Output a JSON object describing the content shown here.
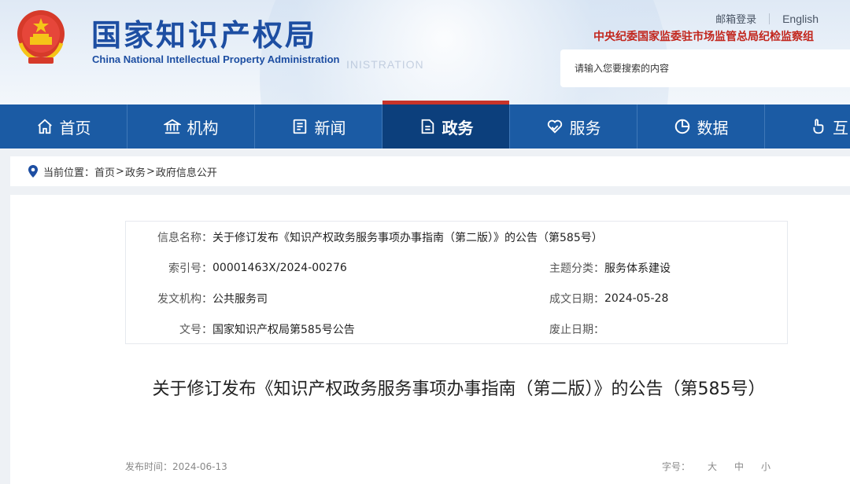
{
  "header": {
    "site_title": "国家知识产权局",
    "site_subtitle": "China National Intellectual Property Administration",
    "faint_text": "INISTRATION",
    "top_links": {
      "mail": "邮箱登录",
      "english": "English"
    },
    "org_note": "中央纪委国家监委驻市场监管总局纪检监察组",
    "search": {
      "placeholder": "请输入您要搜索的内容",
      "value": ""
    }
  },
  "nav": {
    "items": [
      {
        "label": "首页",
        "icon": "home-icon"
      },
      {
        "label": "机构",
        "icon": "institution-icon"
      },
      {
        "label": "新闻",
        "icon": "news-icon"
      },
      {
        "label": "政务",
        "icon": "document-icon",
        "active": true
      },
      {
        "label": "服务",
        "icon": "heart-hand-icon"
      },
      {
        "label": "数据",
        "icon": "pie-chart-icon"
      },
      {
        "label": "互",
        "icon": "hand-pointer-icon"
      }
    ]
  },
  "breadcrumb": {
    "prefix": "当前位置：",
    "items": [
      "首页",
      "政务",
      "政府信息公开"
    ],
    "separator": ">"
  },
  "info": {
    "name_label": "信息名称：",
    "name_value": "关于修订发布《知识产权政务服务事项办事指南（第二版）》的公告（第585号）",
    "index_label": "索引号：",
    "index_value": "00001463X/2024-00276",
    "topic_label": "主题分类：",
    "topic_value": "服务体系建设",
    "issuer_label": "发文机构：",
    "issuer_value": "公共服务司",
    "date_label": "成文日期：",
    "date_value": "2024-05-28",
    "docno_label": "文号：",
    "docno_value": "国家知识产权局第585号公告",
    "expire_label": "废止日期：",
    "expire_value": ""
  },
  "article": {
    "title": "关于修订发布《知识产权政务服务事项办事指南（第二版）》的公告（第585号）",
    "publish_label": "发布时间：",
    "publish_date": "2024-06-13",
    "font_size_label": "字号：",
    "font_sizes": [
      "大",
      "中",
      "小"
    ]
  },
  "colors": {
    "brand_blue": "#1d4ea2",
    "nav_blue": "#1b5ba4",
    "nav_active": "#0c3f7c",
    "accent_red": "#c8342a"
  }
}
